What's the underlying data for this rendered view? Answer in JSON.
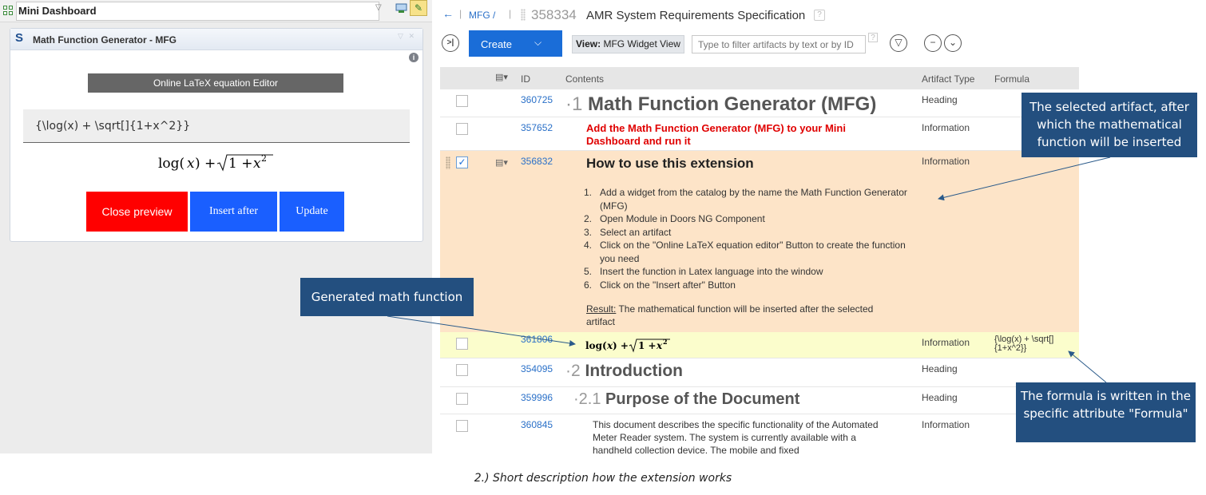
{
  "mini_dashboard": {
    "title": "Mini Dashboard",
    "widget": {
      "title": "Math Function Generator - MFG",
      "latex_editor_button": "Online LaTeX equation Editor",
      "latex_input_value": "{\\log(x) + \\sqrt[]{1+x^2}}",
      "preview": "log(x) + √(1 + x²)",
      "buttons": {
        "close_preview": "Close preview",
        "insert_after": "Insert after",
        "update": "Update"
      }
    }
  },
  "module": {
    "breadcrumb": "MFG /",
    "artifact_id": "358334",
    "title": "AMR System Requirements Specification",
    "help": "?",
    "toolbar": {
      "create_label": "Create",
      "view_prefix": "View:",
      "view_name": "MFG Widget View",
      "filter_placeholder": "Type to filter artifacts by text or by ID",
      "filter_help": "?"
    },
    "table": {
      "headers": {
        "id": "ID",
        "contents": "Contents",
        "artifact_type": "Artifact Type",
        "formula": "Formula"
      },
      "rows": [
        {
          "id": "360725",
          "number": "1",
          "content": "Math Function Generator (MFG)",
          "type": "Heading",
          "formula": ""
        },
        {
          "id": "357652",
          "content": "Add the Math Function Generator (MFG) to your Mini Dashboard and run it",
          "type": "Information",
          "formula": ""
        },
        {
          "id": "356832",
          "content": "How to use this extension",
          "type": "Information",
          "formula": "",
          "selected": true,
          "list": [
            "Add a widget from the catalog by the name the Math Function Generator (MFG)",
            "Open Module in Doors NG Component",
            "Select an artifact",
            "Click on the \"Online LaTeX equation editor\" Button to create the function you need",
            "Insert the function in Latex language into the window",
            "Click on the \"Insert after\" Button"
          ],
          "result_label": "Result:",
          "result_text": " The mathematical function will be inserted after the selected artifact"
        },
        {
          "id": "361806",
          "content": "log(x) + √(1 + x²)",
          "type": "Information",
          "formula": "{\\log(x) + \\sqrt[]{1+x^2}}",
          "formula_line1": "{\\log(x) + \\sqrt[]",
          "formula_line2": "{1+x^2}}"
        },
        {
          "id": "354095",
          "number": "2",
          "content": "Introduction",
          "type": "Heading",
          "formula": ""
        },
        {
          "id": "359996",
          "number": "2.1",
          "content": "Purpose of the Document",
          "type": "Heading",
          "formula": ""
        },
        {
          "id": "360845",
          "content": "This document describes the specific functionality of the Automated Meter Reader system. The system is currently available with a handheld collection device. The mobile and fixed",
          "type": "Information",
          "formula": ""
        }
      ]
    }
  },
  "annotations": {
    "generated": "Generated math function",
    "selected_artifact": "The selected artifact, after which the mathematical function will be inserted",
    "formula_attr": "The formula is written in the specific attribute \"Formula\"",
    "caption": "2.) Short description how the extension works"
  },
  "colors": {
    "selected_row": "#fde4c8",
    "inserted_row": "#fbfdcc",
    "callout": "#234f7f",
    "primary": "#1a6dd8",
    "close_button": "#ff0000"
  }
}
